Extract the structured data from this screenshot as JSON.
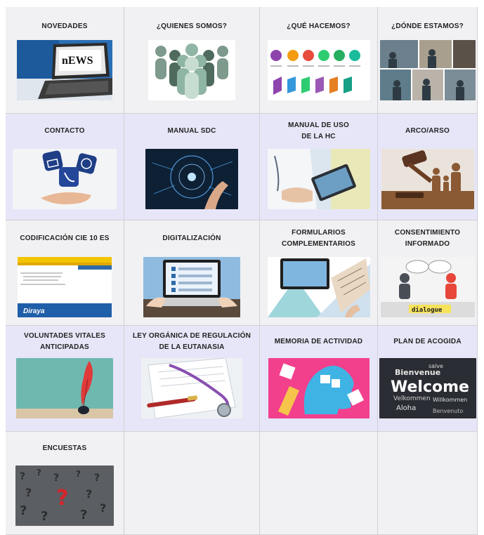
{
  "tiles": [
    {
      "label": "NOVEDADES",
      "icon": "news-laptop-icon"
    },
    {
      "label": "¿QUIENES SOMOS?",
      "icon": "people-group-icon"
    },
    {
      "label": "¿QUÉ HACEMOS?",
      "icon": "process-steps-icon"
    },
    {
      "label": "¿DÓNDE ESTAMOS?",
      "icon": "offices-photo-icon"
    },
    {
      "label": "CONTACTO",
      "icon": "contact-dice-icon"
    },
    {
      "label": "MANUAL SDC",
      "icon": "digital-touch-icon"
    },
    {
      "label": "MANUAL DE USO\nDE LA HC",
      "icon": "doctor-tablet-icon"
    },
    {
      "label": "ARCO/ARSO",
      "icon": "gavel-family-icon"
    },
    {
      "label": "CODIFICACIÓN CIE 10 ES",
      "icon": "diraya-screen-icon"
    },
    {
      "label": "DIGITALIZACIÓN",
      "icon": "laptop-checklist-icon"
    },
    {
      "label": "FORMULARIOS\nCOMPLEMENTARIOS",
      "icon": "forms-collage-icon"
    },
    {
      "label": "CONSENTIMIENTO\nINFORMADO",
      "icon": "dialogue-icon"
    },
    {
      "label": "VOLUNTADES VITALES\nANTICIPADAS",
      "icon": "quill-pen-icon"
    },
    {
      "label": "LEY ORGÁNICA DE REGULACIÓN\nDE LA EUTANASIA",
      "icon": "stethoscope-pen-icon"
    },
    {
      "label": "MEMORIA DE ACTIVIDAD",
      "icon": "brain-puzzle-icon"
    },
    {
      "label": "PLAN DE ACOGIDA",
      "icon": "welcome-words-icon"
    },
    {
      "label": "ENCUESTAS",
      "icon": "question-marks-icon"
    }
  ],
  "thumb_text": {
    "news": "nEWS",
    "diraya": "Diraya",
    "dialogue": "dialogue",
    "welcome": "Welcome",
    "bienvenue": "Bienvenue",
    "willkommen": "Willkommen",
    "velkommen": "Velkommen",
    "aloha": "Aloha",
    "salve": "salve",
    "benvenuto": "Benvenuto"
  }
}
